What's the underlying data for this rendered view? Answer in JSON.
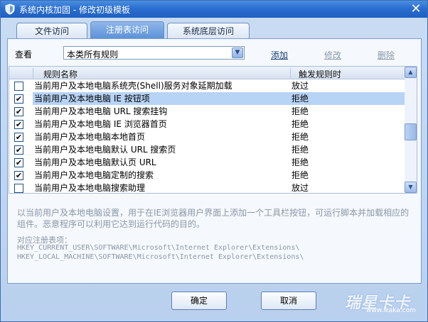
{
  "window": {
    "title": "系统内核加固 - 修改初级模板",
    "close_glyph": "✕"
  },
  "tabs": [
    {
      "label": "文件访问",
      "active": false
    },
    {
      "label": "注册表访问",
      "active": true
    },
    {
      "label": "系统底层访问",
      "active": false
    }
  ],
  "filter": {
    "label": "查看",
    "selected": "本类所有规则"
  },
  "actions": {
    "add": "添加",
    "edit": "修改",
    "delete": "删除"
  },
  "table": {
    "columns": [
      "规则名称",
      "触发规则时"
    ],
    "rows": [
      {
        "checked": false,
        "name": "当前用户及本地电脑系统壳(Shell)服务对象延期加载",
        "trigger": "放过",
        "selected": false
      },
      {
        "checked": true,
        "name": "当前用户及本地电脑 IE 按钮项",
        "trigger": "拒绝",
        "selected": true
      },
      {
        "checked": true,
        "name": "当前用户及本地电脑 URL 搜索挂钩",
        "trigger": "拒绝",
        "selected": false
      },
      {
        "checked": true,
        "name": "当前用户及本地电脑 IE 浏览器首页",
        "trigger": "拒绝",
        "selected": false
      },
      {
        "checked": true,
        "name": "当前用户及本地电脑本地首页",
        "trigger": "拒绝",
        "selected": false
      },
      {
        "checked": true,
        "name": "当前用户及本地电脑默认 URL 搜索页",
        "trigger": "拒绝",
        "selected": false
      },
      {
        "checked": true,
        "name": "当前用户及本地电脑默认页 URL",
        "trigger": "拒绝",
        "selected": false
      },
      {
        "checked": true,
        "name": "当前用户及本地电脑定制的搜索",
        "trigger": "拒绝",
        "selected": false
      },
      {
        "checked": false,
        "name": "当前用户及本地电脑搜索助理",
        "trigger": "放过",
        "selected": false
      }
    ]
  },
  "description": "以当前用户及本地电脑设置，用于在IE浏览器用户界面上添加一个工具栏按钮，可运行脚本并加载相应的组件。恶意程序可以利用它达到运行代码的目的。",
  "registry": {
    "title": "对应注册表项：",
    "paths": [
      "HKEY_CURRENT_USER\\SOFTWARE\\Microsoft\\Internet Explorer\\Extensions\\",
      "HKEY_LOCAL_MACHINE\\SOFTWARE\\Microsoft\\Internet Explorer\\Extensions\\"
    ]
  },
  "buttons": {
    "ok": "确定",
    "cancel": "取消"
  },
  "watermark": {
    "text": "瑞星卡卡",
    "url": "www.ikaka.com"
  },
  "colors": {
    "titlebar": "#2a6ed0",
    "selection": "#b7d3f5",
    "window_bg": "#c9dcf3"
  }
}
